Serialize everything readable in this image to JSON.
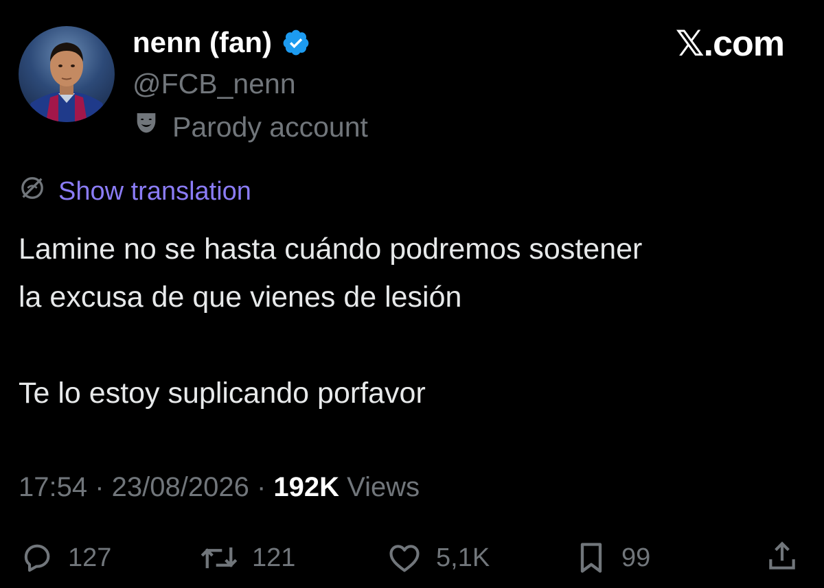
{
  "author": {
    "display_name": "nenn (fan)",
    "handle": "@FCB_nenn",
    "label": "Parody account",
    "verified_icon": "verified-badge-icon",
    "label_icon": "parody-mask-icon"
  },
  "brand": "𝕏.com",
  "translation": {
    "link_text": "Show translation",
    "icon": "translate-globe-icon"
  },
  "tweet": {
    "text": "Lamine no se hasta cuándo podremos sostener\nla excusa de que vienes de lesión\n\nTe lo estoy suplicando porfavor"
  },
  "meta": {
    "time": "17:54",
    "separator": " · ",
    "date": "23/08/2026",
    "views_count": "192K",
    "views_label": " Views"
  },
  "actions": {
    "replies": "127",
    "reposts": "121",
    "likes": "5,1K",
    "bookmarks": "99"
  },
  "colors": {
    "background": "#000000",
    "primary_text": "#e7e9ea",
    "secondary_text": "#71767b",
    "link": "#8b7cf6",
    "verified": "#1d9bf0"
  }
}
